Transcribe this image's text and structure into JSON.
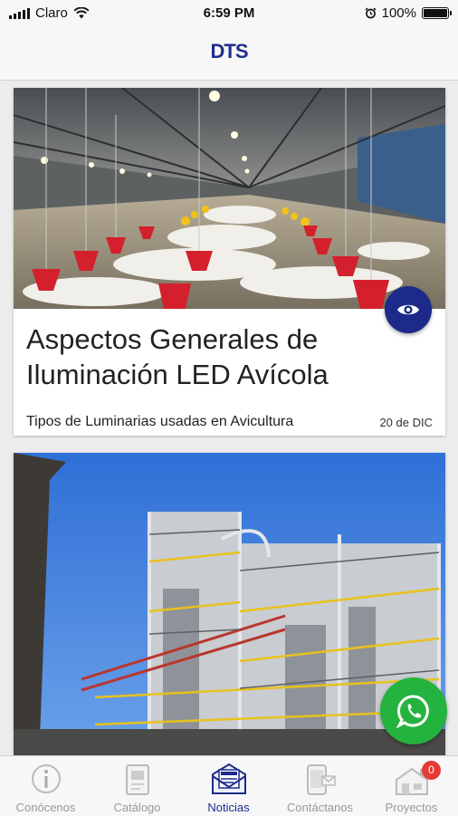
{
  "status_bar": {
    "carrier": "Claro",
    "time": "6:59 PM",
    "battery": "100%",
    "battery_level": 1.0
  },
  "header": {
    "logo_text": "DTS"
  },
  "articles": [
    {
      "title": "Aspectos Generales de Iluminación LED Avícola",
      "subtitle": "Tipos de Luminarias usadas en Avicultura",
      "date": "20 de DIC",
      "image": "poultry-house-photo"
    },
    {
      "image": "industrial-plant-photo"
    }
  ],
  "tabs": [
    {
      "label": "Conócenos",
      "icon": "info-icon"
    },
    {
      "label": "Catálogo",
      "icon": "catalog-icon"
    },
    {
      "label": "Noticias",
      "icon": "news-icon",
      "active": true
    },
    {
      "label": "Contáctanos",
      "icon": "contact-icon"
    },
    {
      "label": "Proyectos",
      "icon": "projects-icon",
      "badge": "0"
    }
  ],
  "colors": {
    "brand": "#1e2a8a",
    "whatsapp": "#25b33f",
    "badge": "#e53935"
  }
}
